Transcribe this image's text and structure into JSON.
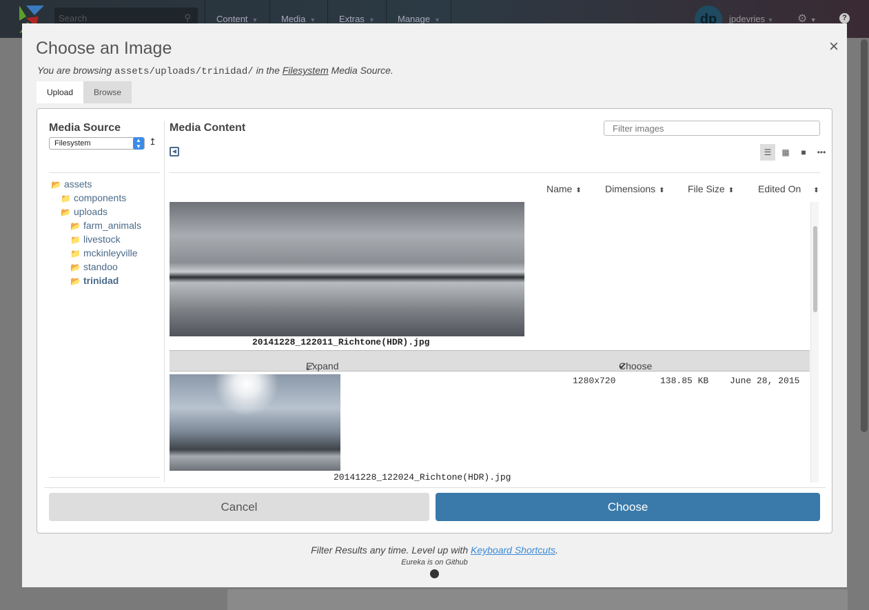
{
  "topbar": {
    "search_placeholder": "Search",
    "nav": [
      "Content",
      "Media",
      "Extras",
      "Manage"
    ],
    "username": "jpdevries",
    "avatar_initials": "dp"
  },
  "modal": {
    "title": "Choose an Image",
    "close": "×",
    "subtitle": {
      "prefix": "You are browsing",
      "path": "assets/uploads/trinidad/",
      "middle": "in the",
      "source": "Filesystem",
      "suffix": "Media Source."
    },
    "tabs": [
      "Upload",
      "Browse"
    ],
    "media_source": {
      "title": "Media Source",
      "selected": "Filesystem"
    },
    "tree": [
      {
        "label": "assets",
        "level": 0
      },
      {
        "label": "components",
        "level": 1
      },
      {
        "label": "uploads",
        "level": 1
      },
      {
        "label": "farm_animals",
        "level": 2
      },
      {
        "label": "livestock",
        "level": 2
      },
      {
        "label": "mckinleyville",
        "level": 2
      },
      {
        "label": "standoo",
        "level": 2
      },
      {
        "label": "trinidad",
        "level": 2,
        "active": true
      }
    ],
    "content": {
      "title": "Media Content",
      "filter_placeholder": "Filter images",
      "columns": [
        "Name",
        "Dimensions",
        "File Size",
        "Edited On"
      ],
      "files": [
        {
          "name": "20141228_122011_Richtone(HDR).jpg"
        },
        {
          "name": "20141228_122024_Richtone(HDR).jpg",
          "dimensions": "1280x720",
          "size": "138.85 KB",
          "edited": "June 28, 2015"
        }
      ],
      "expand": "Expand",
      "choose": "Choose"
    },
    "buttons": {
      "cancel": "Cancel",
      "choose": "Choose"
    },
    "footer": {
      "line1_prefix": "Filter Results any time. Level up with",
      "line1_link": "Keyboard Shortcuts",
      "line2": "Eureka is on Github"
    }
  }
}
